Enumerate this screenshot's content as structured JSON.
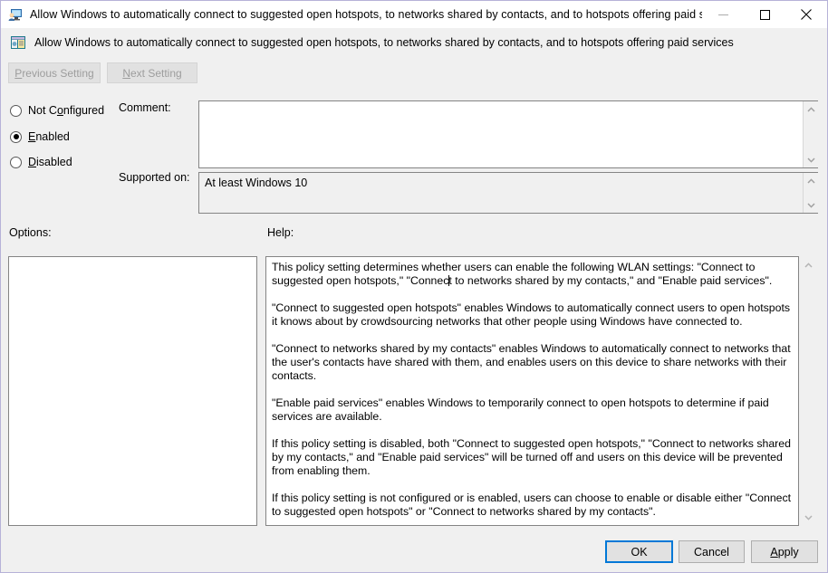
{
  "window": {
    "title": "Allow Windows to automatically connect to suggested open hotspots, to networks shared by contacts, and to hotspots offering paid services",
    "titlebar_icon": "policy-monitor-icon",
    "controls": {
      "minimize_label": "Minimize",
      "maximize_label": "Maximize",
      "close_label": "Close"
    }
  },
  "header": {
    "icon": "policy-setting-icon",
    "title": "Allow Windows to automatically connect to suggested open hotspots, to networks shared by contacts, and to hotspots offering paid services"
  },
  "nav": {
    "previous_pre": "P",
    "previous_post": "revious Setting",
    "next_pre": "N",
    "next_post": "ext Setting"
  },
  "state": {
    "options": [
      {
        "id": "not-configured",
        "pre": "Not C",
        "acc": "o",
        "post": "nfigured",
        "selected": false
      },
      {
        "id": "enabled",
        "pre": "",
        "acc": "E",
        "post": "nabled",
        "selected": true
      },
      {
        "id": "disabled",
        "pre": "",
        "acc": "D",
        "post": "isabled",
        "selected": false
      }
    ]
  },
  "fields": {
    "comment_label": "Comment:",
    "comment_value": "",
    "supported_label": "Supported on:",
    "supported_value": "At least Windows 10",
    "options_label": "Options:",
    "help_label": "Help:"
  },
  "help": {
    "paragraphs": [
      {
        "before": "This policy setting determines whether users can enable the following WLAN settings: \"Connect to suggested open hotspots,\" \"Connec",
        "caret": true,
        "after": "t to networks shared by my contacts,\" and \"Enable paid services\"."
      },
      {
        "before": "\"Connect to suggested open hotspots\" enables Windows to automatically connect users to open hotspots it knows about by crowdsourcing networks that other people using Windows have connected to.",
        "caret": false,
        "after": ""
      },
      {
        "before": "\"Connect to networks shared by my contacts\" enables Windows to automatically connect to networks that the user's contacts have shared with them, and enables users on this device to share networks with their contacts.",
        "caret": false,
        "after": ""
      },
      {
        "before": "\"Enable paid services\" enables Windows to temporarily connect to open hotspots to determine if paid services are available.",
        "caret": false,
        "after": ""
      },
      {
        "before": "If this policy setting is disabled, both \"Connect to suggested open hotspots,\" \"Connect to networks shared by my contacts,\" and \"Enable paid services\" will be turned off and users on this device will be prevented from enabling them.",
        "caret": false,
        "after": ""
      },
      {
        "before": "If this policy setting is not configured or is enabled, users can choose to enable or disable either \"Connect to suggested open hotspots\"  or \"Connect to networks shared by my contacts\".",
        "caret": false,
        "after": ""
      }
    ]
  },
  "buttons": {
    "ok": "OK",
    "cancel": "Cancel",
    "apply_pre": "A",
    "apply_post": "pply"
  },
  "scrollbars": {
    "up_icon": "chevron-up-icon",
    "down_icon": "chevron-down-icon"
  },
  "colors": {
    "dialog_bg": "#f0f0f0",
    "window_border": "#b6b2d8",
    "default_button_accent": "#0078d7",
    "disabled_text": "#9d9d9d",
    "textbox_border": "#848484"
  }
}
